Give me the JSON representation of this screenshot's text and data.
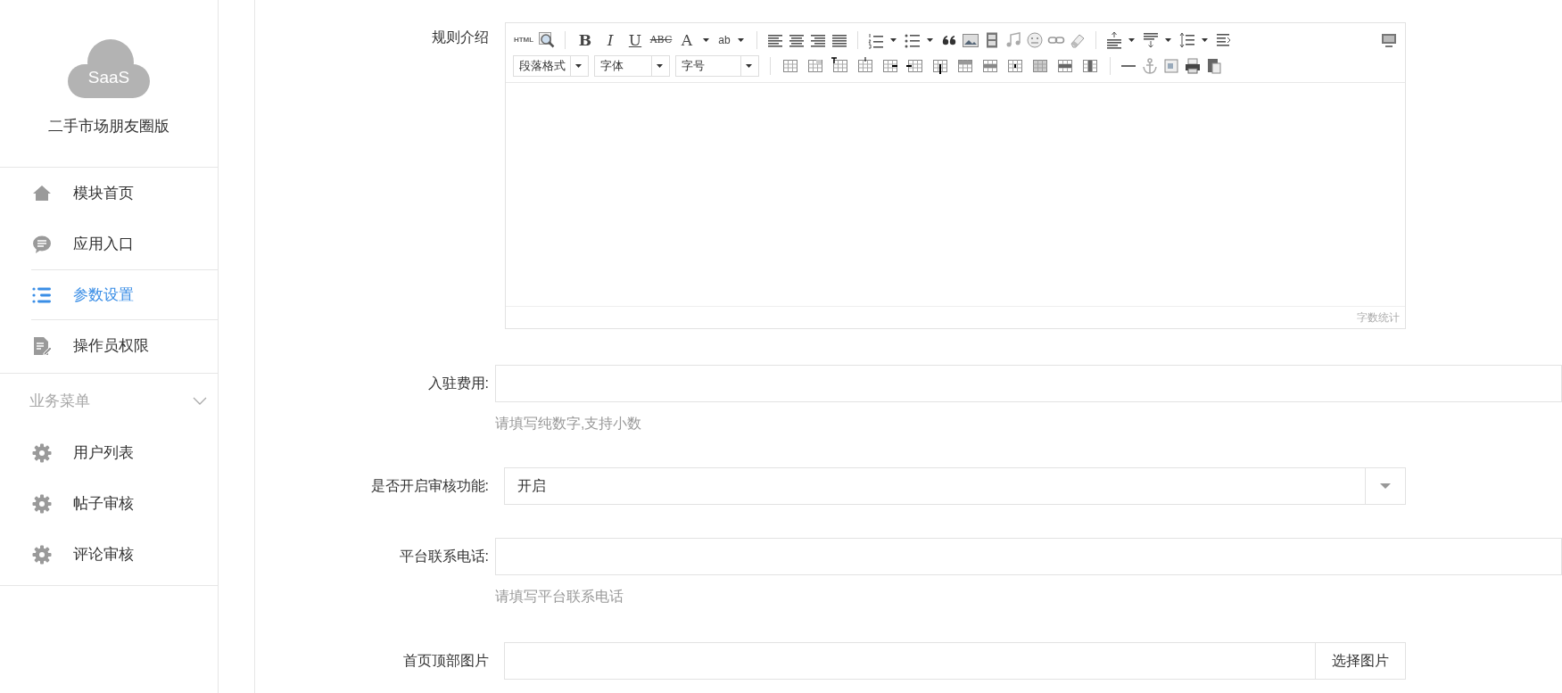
{
  "sidebar": {
    "logo_text": "SaaS",
    "app_name": "二手市场朋友圈版",
    "items": [
      {
        "label": "模块首页",
        "selected": false
      },
      {
        "label": "应用入口",
        "selected": false
      },
      {
        "label": "参数设置",
        "selected": true
      },
      {
        "label": "操作员权限",
        "selected": false
      }
    ],
    "business_menu": {
      "title": "业务菜单",
      "expanded": true,
      "items": [
        {
          "label": "用户列表",
          "selected": false
        },
        {
          "label": "帖子审核",
          "selected": false
        },
        {
          "label": "评论审核",
          "selected": false
        }
      ]
    }
  },
  "form": {
    "rules": {
      "label": "规则介绍",
      "editor": {
        "toolbar_glyphs": [
          "HTML",
          "B",
          "I",
          "U",
          "ABC",
          "A",
          "ab"
        ],
        "dropdowns": [
          "段落格式",
          "字体",
          "字号"
        ],
        "footer": "字数统计"
      }
    },
    "fee": {
      "label": "入驻费用:",
      "hint": "请填写纯数字,支持小数"
    },
    "review": {
      "label": "是否开启审核功能:",
      "value": "开启"
    },
    "phone": {
      "label": "平台联系电话:",
      "hint": "请填写平台联系电话"
    },
    "banner": {
      "label": "首页顶部图片",
      "button": "选择图片"
    }
  }
}
